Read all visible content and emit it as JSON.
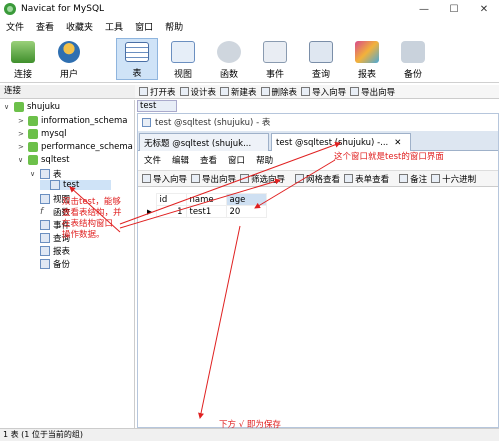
{
  "app": {
    "title": "Navicat for MySQL",
    "window_buttons": [
      "—",
      "☐",
      "✕"
    ]
  },
  "menu": [
    "文件",
    "查看",
    "收藏夹",
    "工具",
    "窗口",
    "帮助"
  ],
  "toolbar": [
    {
      "label": "连接",
      "icon": "connection-icon"
    },
    {
      "label": "用户",
      "icon": "user-icon"
    },
    {
      "label": "表",
      "icon": "table-icon",
      "selected": true
    },
    {
      "label": "视图",
      "icon": "view-icon"
    },
    {
      "label": "函数",
      "icon": "function-icon"
    },
    {
      "label": "事件",
      "icon": "event-icon"
    },
    {
      "label": "查询",
      "icon": "query-icon"
    },
    {
      "label": "报表",
      "icon": "report-icon"
    },
    {
      "label": "备份",
      "icon": "backup-icon"
    }
  ],
  "sidebar": {
    "header": "连接",
    "tree": [
      {
        "label": "shujuku"
      },
      {
        "label": "information_schema"
      },
      {
        "label": "mysql"
      },
      {
        "label": "performance_schema"
      },
      {
        "label": "sqltest"
      },
      {
        "label": "表"
      },
      {
        "label": "test"
      },
      {
        "label": "视图"
      },
      {
        "label": "函数"
      },
      {
        "label": "事件"
      },
      {
        "label": "查询"
      },
      {
        "label": "报表"
      },
      {
        "label": "备份"
      }
    ]
  },
  "object_bar": [
    "打开表",
    "设计表",
    "新建表",
    "删除表",
    "导入向导",
    "导出向导"
  ],
  "object_tab": "test",
  "subwindow": {
    "title": "test @sqltest (shujuku) - 表",
    "tabs": [
      "无标题 @sqltest (shujuk...",
      "test @sqltest (shujuku) -..."
    ],
    "close": "✕",
    "menu": [
      "文件",
      "编辑",
      "查看",
      "窗口",
      "帮助"
    ],
    "toolbar": [
      "导入向导",
      "导出向导",
      "筛选向导",
      "网格查看",
      "表单查看",
      "备注",
      "十六进制"
    ]
  },
  "grid": {
    "columns": [
      "id",
      "name",
      "age"
    ],
    "rows": [
      [
        "1",
        "test1",
        "20"
      ]
    ]
  },
  "annotations": {
    "window_note": "这个窗口就是test的窗口界面",
    "dblclick_note": [
      "双击test，能够",
      "查看表结构，并",
      "在表结构窗口",
      "操作数据。"
    ],
    "save_note": "下方 √ 即为保存"
  },
  "status": "1 表 (1 位于当前的组)",
  "colors": {
    "annotation": "#e02020",
    "selected_tab": "#cfe3f7",
    "accent": "#6b8fc0"
  }
}
